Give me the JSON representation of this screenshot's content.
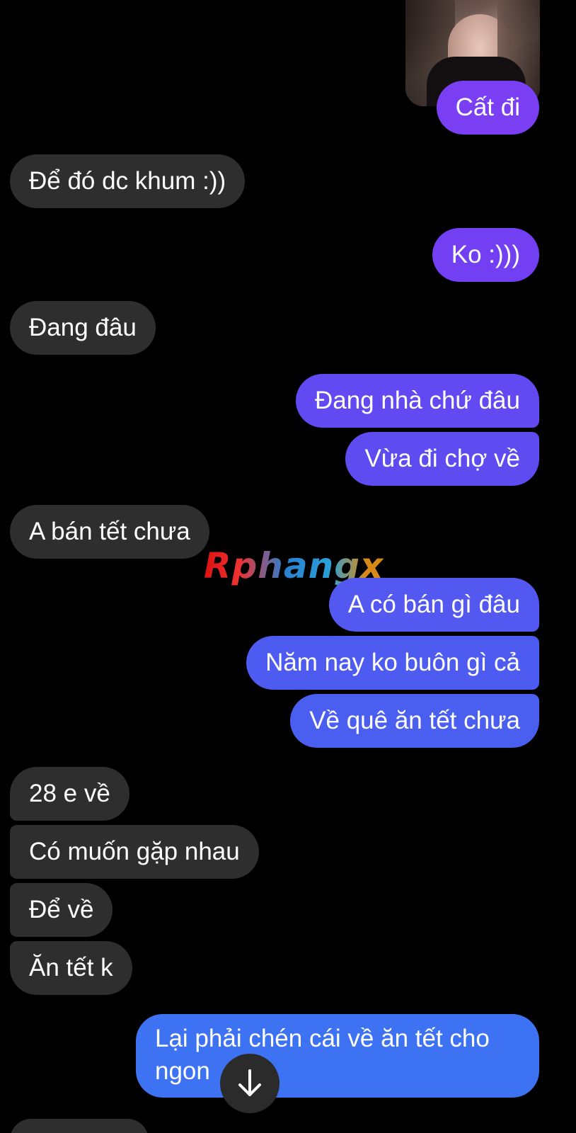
{
  "colors": {
    "background": "#000000",
    "incoming_bubble": "#2e2e2e",
    "outgoing_gradient": [
      "#7a3ff2",
      "#5e52f0",
      "#4a5cf0",
      "#3d72f2"
    ],
    "text": "#ffffff"
  },
  "photo": {
    "alt": "photo-attachment"
  },
  "messages": [
    {
      "dir": "out",
      "text": "Cất đi"
    },
    {
      "dir": "in",
      "text": "Để đó dc khum :))"
    },
    {
      "dir": "out",
      "text": "Ko :)))"
    },
    {
      "dir": "in",
      "text": "Đang đâu"
    },
    {
      "dir": "out",
      "text": "Đang nhà chứ đâu"
    },
    {
      "dir": "out",
      "text": "Vừa đi chợ về"
    },
    {
      "dir": "in",
      "text": "A bán tết chưa"
    },
    {
      "dir": "out",
      "text": "A có bán gì đâu"
    },
    {
      "dir": "out",
      "text": "Năm nay ko buôn gì cả"
    },
    {
      "dir": "out",
      "text": "Về quê ăn tết chưa"
    },
    {
      "dir": "in",
      "text": "28 e về"
    },
    {
      "dir": "in",
      "text": "Có muốn gặp nhau"
    },
    {
      "dir": "in",
      "text": "Để về"
    },
    {
      "dir": "in",
      "text": "Ăn tết k"
    },
    {
      "dir": "out",
      "text": "Lại phải chén cái về ăn tết cho ngon"
    }
  ],
  "watermark": "Rphangx",
  "scroll_button": {
    "icon": "arrow-down-icon"
  }
}
